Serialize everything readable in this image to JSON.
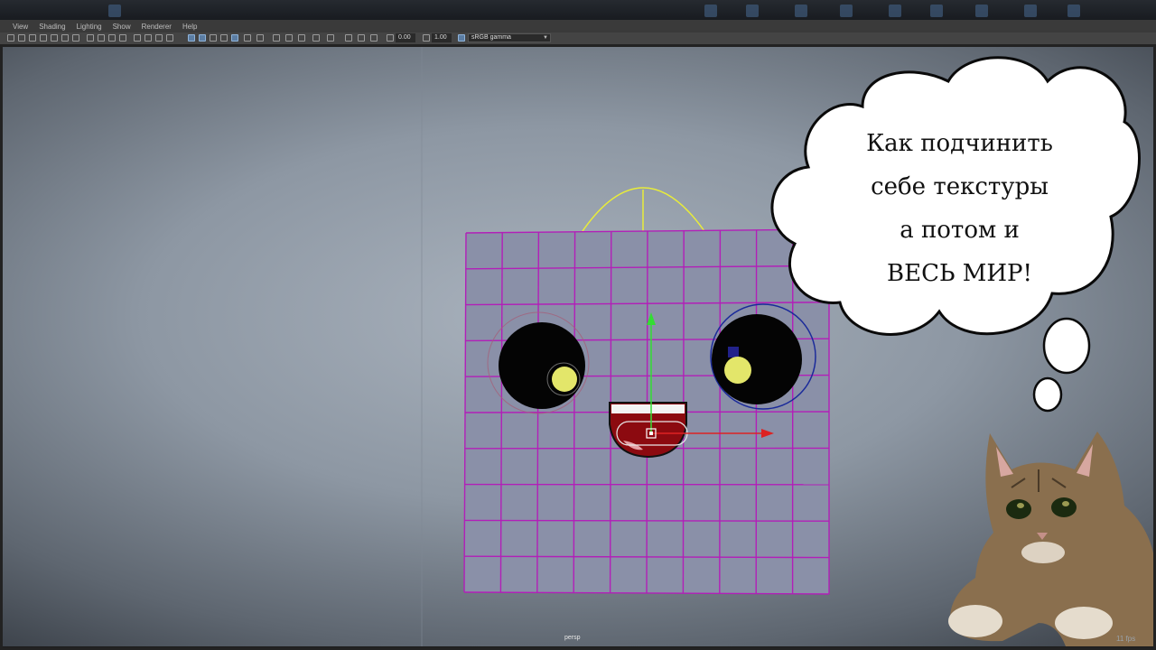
{
  "taskbar": {
    "icons": [
      "app-icon",
      "doc-icon",
      "doc-icon",
      "doc-icon",
      "doc-icon",
      "doc-icon",
      "doc-icon",
      "doc-icon",
      "doc-icon",
      "doc-icon"
    ]
  },
  "menubar": {
    "items": [
      "View",
      "Shading",
      "Lighting",
      "Show",
      "Renderer",
      "Help"
    ]
  },
  "toolbar": {
    "exposure_value": "0.00",
    "gamma_value": "1.00",
    "color_space": "sRGB gamma"
  },
  "viewport": {
    "camera_label": "persp",
    "fps_label": "11 fps",
    "colors": {
      "grid": "#b21fb8",
      "plane": "#8a90a8",
      "y_axis": "#33dd33",
      "x_axis": "#dd2222",
      "light_arc": "#e8ec3a",
      "mouth": "#8c0a10",
      "highlight": "#e3e66a"
    }
  },
  "speech_bubble": {
    "lines": [
      "Как подчинить",
      "себе текстуры",
      "а потом и",
      "ВЕСЬ МИР!"
    ]
  },
  "overlay": {
    "cat": "cat-photo"
  }
}
